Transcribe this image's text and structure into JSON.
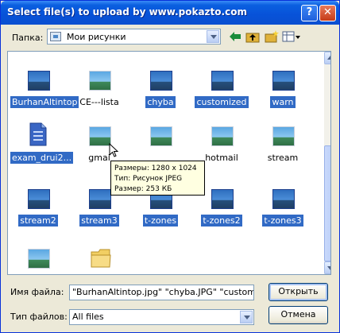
{
  "window": {
    "title": "Select file(s) to upload by www.pokazto.com",
    "help_label": "?",
    "close_label": "✕"
  },
  "location": {
    "label": "Папка:",
    "value": "Мои рисунки",
    "icon": "my-pictures-icon"
  },
  "toolbar": [
    {
      "name": "back-icon",
      "color": "#1a8c3a"
    },
    {
      "name": "up-folder-icon",
      "color": "#e0b23a"
    },
    {
      "name": "new-folder-icon",
      "color": "#e0b23a"
    },
    {
      "name": "view-menu-icon",
      "color": "#4d6185"
    }
  ],
  "files": [
    {
      "label": "BurhanAltintop",
      "selected": true,
      "icon": "image-thumbnail"
    },
    {
      "label": "CE---lista",
      "selected": false,
      "icon": "image-thumbnail"
    },
    {
      "label": "chyba",
      "selected": true,
      "icon": "image-thumbnail"
    },
    {
      "label": "customized",
      "selected": true,
      "icon": "image-thumbnail"
    },
    {
      "label": "warn",
      "selected": true,
      "icon": "image-thumbnail"
    },
    {
      "label": "exam_drui2...",
      "selected": true,
      "icon": "document-icon"
    },
    {
      "label": "gmai",
      "selected": false,
      "icon": "image-thumbnail"
    },
    {
      "label": "",
      "selected": false,
      "icon": "image-thumbnail"
    },
    {
      "label": "hotmail",
      "selected": false,
      "icon": "image-thumbnail"
    },
    {
      "label": "stream",
      "selected": false,
      "icon": "image-thumbnail"
    },
    {
      "label": "stream2",
      "selected": true,
      "icon": "image-thumbnail"
    },
    {
      "label": "stream3",
      "selected": true,
      "icon": "image-thumbnail"
    },
    {
      "label": "t-zones",
      "selected": true,
      "icon": "image-thumbnail"
    },
    {
      "label": "t-zones2",
      "selected": true,
      "icon": "image-thumbnail"
    },
    {
      "label": "t-zones3",
      "selected": true,
      "icon": "image-thumbnail"
    },
    {
      "label": "",
      "selected": false,
      "icon": "image-thumbnail"
    },
    {
      "label": "",
      "selected": false,
      "icon": "folder-icon"
    }
  ],
  "tooltip": {
    "line1": "Размеры: 1280 x 1024",
    "line2": "Тип: Рисунок JPEG",
    "line3": "Размер: 253 КБ"
  },
  "filename": {
    "label": "Имя файла:",
    "value": "\"BurhanAltintop.jpg\" \"chyba.JPG\" \"customized."
  },
  "filetype": {
    "label": "Тип файлов:",
    "value": "All files"
  },
  "buttons": {
    "open": "Открыть",
    "cancel": "Отмена"
  }
}
